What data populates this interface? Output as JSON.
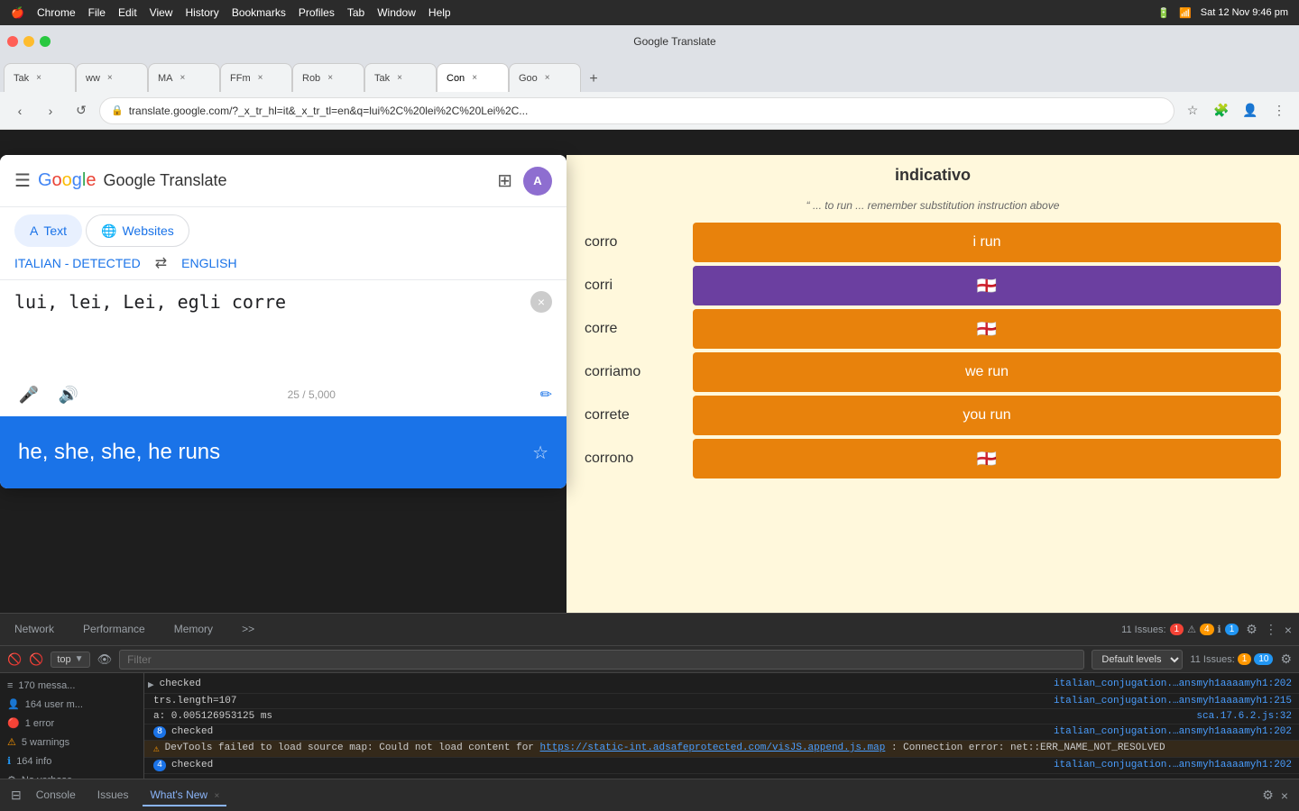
{
  "macbar": {
    "apple": "🍎",
    "menu_items": [
      "Chrome",
      "File",
      "Edit",
      "View",
      "History",
      "Bookmarks",
      "Profiles",
      "Tab",
      "Window",
      "Help"
    ],
    "datetime": "Sat 12 Nov  9:46 pm",
    "battery_icon": "🔋"
  },
  "chrome": {
    "title": "Google Translate",
    "url": "translate.google.com/?_x_tr_hl=it&_x_tr_tl=en&q=lui%2C%20lei%2C%20Lei%2C...",
    "tabs": [
      {
        "label": "Tak",
        "active": false
      },
      {
        "label": "ww",
        "active": false
      },
      {
        "label": "MA",
        "active": false
      },
      {
        "label": "FFm",
        "active": false
      },
      {
        "label": "Rob",
        "active": false
      },
      {
        "label": "Tak",
        "active": false
      },
      {
        "label": "Con",
        "active": true
      },
      {
        "label": "Goo",
        "active": false
      }
    ]
  },
  "translate": {
    "title": "Google Translate",
    "menu_label": "☰",
    "grid_label": "⊞",
    "avatar_initials": "A",
    "tab_text": "Text",
    "tab_websites": "Websites",
    "source_lang": "ITALIAN - DETECTED",
    "swap_icon": "⇄",
    "target_lang": "ENGLISH",
    "input_text": "lui, lei, Lei, egli corre",
    "char_count": "25 / 5,000",
    "output_text": "he, she, she, he runs",
    "clear_icon": "×",
    "mic_icon": "🎤",
    "speaker_icon": "🔊",
    "edit_icon": "✏",
    "star_icon": "☆"
  },
  "conjugation": {
    "title": "indicativo",
    "subtitle": "... to run ... remember substitution instruction above",
    "rows": [
      {
        "pronoun": "corro",
        "translation": "i run",
        "style": "orange",
        "show_flag": false
      },
      {
        "pronoun": "corri",
        "translation": "",
        "style": "purple",
        "show_flag": true
      },
      {
        "pronoun": "corre",
        "translation": "",
        "style": "orange",
        "show_flag": true
      },
      {
        "pronoun": "corriamo",
        "translation": "we run",
        "style": "orange",
        "show_flag": false
      },
      {
        "pronoun": "correte",
        "translation": "you run",
        "style": "orange",
        "show_flag": false
      },
      {
        "pronoun": "corrono",
        "translation": "",
        "style": "orange",
        "show_flag": true
      }
    ]
  },
  "devtools": {
    "tabs": [
      "Network",
      "Performance",
      "Memory"
    ],
    "more_tabs": ">>",
    "issues_label": "11 Issues:",
    "error_count": "1",
    "warning_count": "4",
    "info_count": "1",
    "settings_icon": "⚙",
    "more_icon": "⋮",
    "close_icon": "×",
    "console_toolbar": {
      "top_label": "top",
      "eye_icon": "👁",
      "filter_placeholder": "Filter",
      "default_levels": "Default levels",
      "issues_count": "11 Issues:",
      "err_badge": "1",
      "warn_badge": "10"
    },
    "sidebar_items": [
      {
        "icon": "≡",
        "label": "170 messa...",
        "count": ""
      },
      {
        "icon": "👤",
        "label": "164 user m...",
        "count": ""
      },
      {
        "icon": "🔴",
        "label": "1 error",
        "count": ""
      },
      {
        "icon": "⚠",
        "label": "5 warnings",
        "count": ""
      },
      {
        "icon": "ℹ",
        "label": "164 info",
        "count": ""
      },
      {
        "icon": "⚙",
        "label": "No verbose",
        "count": ""
      }
    ],
    "messages": [
      {
        "type": "info",
        "badge": "",
        "text": "checked",
        "source": "italian_conjugation.…ansmyh1aaaamyh1:202"
      },
      {
        "type": "info",
        "badge": "",
        "text": "trs.length=107",
        "source": "italian_conjugation.…ansmyh1aaaamyh1:215"
      },
      {
        "type": "info",
        "badge": "",
        "text": "a: 0.005126953125 ms",
        "source": "sca.17.6.2.js:32"
      },
      {
        "type": "info",
        "badge": "8",
        "text": "checked",
        "source": "italian_conjugation.…ansmyh1aaaamyh1:202"
      },
      {
        "type": "warning",
        "badge": "",
        "text": "DevTools failed to load source map: Could not load content for ",
        "link": "https://static-int.adsafeprotected.com/visJS.append.js.map",
        "text2": ": Connection error: net::ERR_NAME_NOT_RESOLVED",
        "source": ""
      },
      {
        "type": "info",
        "badge": "4",
        "text": "checked",
        "source": "italian_conjugation.…ansmyh1aaaamyh1:202"
      },
      {
        "type": "expand",
        "badge": "",
        "text": "",
        "source": ""
      }
    ],
    "footer_tabs": [
      "Console",
      "Issues",
      "What's New"
    ],
    "footer_active_tab": "What's New"
  }
}
